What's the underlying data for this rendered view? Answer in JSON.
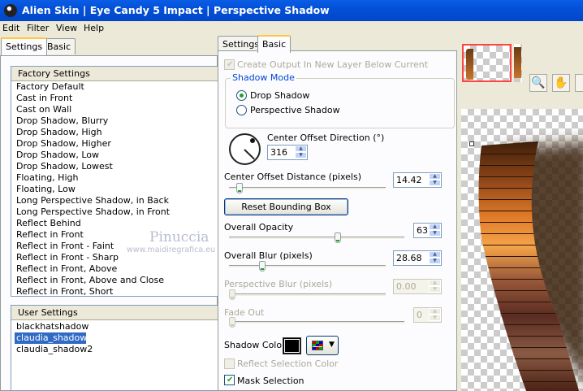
{
  "window": {
    "title": "Alien Skin | Eye Candy 5 Impact | Perspective Shadow"
  },
  "menu": [
    "Edit",
    "Filter",
    "View",
    "Help"
  ],
  "left_tabs": [
    "Settings",
    "Basic"
  ],
  "factory": {
    "header": "Factory Settings",
    "items": [
      "Factory Default",
      "Cast in Front",
      "Cast on Wall",
      "Drop Shadow, Blurry",
      "Drop Shadow, High",
      "Drop Shadow, Higher",
      "Drop Shadow, Low",
      "Drop Shadow, Lowest",
      "Floating, High",
      "Floating, Low",
      "Long Perspective Shadow, in Back",
      "Long Perspective Shadow, in Front",
      "Reflect Behind",
      "Reflect in Front",
      "Reflect in Front - Faint",
      "Reflect in Front - Sharp",
      "Reflect in Front, Above",
      "Reflect in Front, Above and Close",
      "Reflect in Front, Short"
    ]
  },
  "user": {
    "header": "User Settings",
    "items": [
      "blackhatshadow",
      "claudia_shadow1",
      "claudia_shadow2"
    ],
    "selected": "claudia_shadow1"
  },
  "watermark": {
    "line1": "Pinuccia",
    "line2": "www.maidiregrafica.eu"
  },
  "right_tabs": [
    "Settings",
    "Basic"
  ],
  "basic": {
    "create_output": "Create Output In New Layer Below Current",
    "shadow_mode": {
      "legend": "Shadow Mode",
      "options": [
        "Drop Shadow",
        "Perspective Shadow"
      ],
      "selected": "Drop Shadow"
    },
    "center_offset_direction": {
      "label": "Center Offset Direction (°)",
      "value": "316",
      "angle_deg": 316
    },
    "center_offset_distance": {
      "label": "Center Offset Distance (pixels)",
      "value": "14.42",
      "level": 0.05
    },
    "reset_button": "Reset Bounding Box",
    "overall_opacity": {
      "label": "Overall Opacity",
      "value": "63",
      "level": 0.63
    },
    "overall_blur": {
      "label": "Overall Blur (pixels)",
      "value": "28.68",
      "level": 0.2
    },
    "perspective_blur": {
      "label": "Perspective Blur (pixels)",
      "value": "0.00",
      "level": 0
    },
    "fade_out": {
      "label": "Fade Out",
      "value": "0",
      "level": 0
    },
    "shadow_color": {
      "label": "Shadow Color",
      "color": "#000000"
    },
    "reflect_selection_color": "Reflect Selection Color",
    "mask_selection": "Mask Selection"
  },
  "icons": {
    "zoom": "zoom-icon",
    "hand": "hand-icon"
  },
  "colors": {
    "titlebar": "#0350d8",
    "selection": "#316ac5",
    "check": "#21a121"
  }
}
